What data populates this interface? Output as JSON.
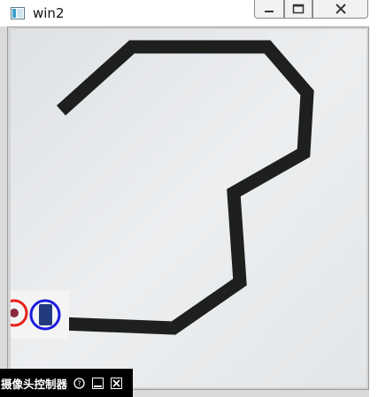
{
  "window": {
    "title": "win2",
    "app_icon": "opencv-window-icon",
    "controls": [
      {
        "name": "minimize-button",
        "icon": "minimize-icon"
      },
      {
        "name": "maximize-button",
        "icon": "maximize-icon"
      },
      {
        "name": "close-button",
        "icon": "close-icon"
      }
    ]
  },
  "camera_view": {
    "content": "camera-frame"
  },
  "camera_controller": {
    "label": "摄像头控制器",
    "help_icon": "help-icon",
    "minimize_icon": "minimize-icon",
    "close_icon": "close-icon"
  },
  "colors": {
    "track": "#1e201e",
    "paper": "#e9ebed",
    "red_marker": "#e8201a",
    "blue_marker": "#1a1ae0",
    "toolbar_bg": "#000000"
  }
}
